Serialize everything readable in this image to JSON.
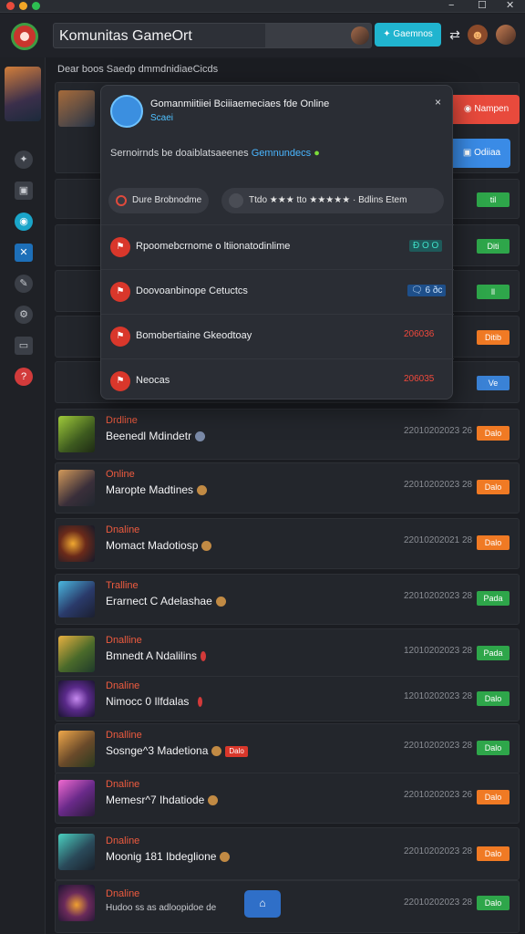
{
  "window": {
    "minimize": "−",
    "maximize": "☐",
    "close": "✕"
  },
  "header": {
    "title": "Komunitas GameOrt",
    "button_label": "Gaemnos",
    "icons": [
      "logo-icon",
      "avatar-icon",
      "swap-icon",
      "game-character-icon",
      "profile-avatar"
    ]
  },
  "main": {
    "title": "Dear boos Saedp dmmdnidiaeCicds"
  },
  "sidebar": {
    "icons": [
      "wrench-icon",
      "chat-icon",
      "globe-icon",
      "close-x-icon",
      "tool-icon",
      "settings-icon",
      "folder-icon",
      "help-icon"
    ]
  },
  "side_actions": [
    {
      "label": "Nampen",
      "color": "#e84a3c"
    },
    {
      "label": "Odiiaa",
      "color": "#3a8be6"
    }
  ],
  "modal": {
    "title": "Gomanmiitiiei Bciiiaemeciaes fde Online",
    "subtitle": "Scaei",
    "close": "×",
    "description": "Sernoirnds be doaiblatsaeenes",
    "description_highlight": "Gemnundecs",
    "chips": [
      {
        "label": "Dure Brobnodme"
      },
      {
        "label": "Ttdo ★★★ tto ★★★★★  · Bdlins Etem"
      }
    ],
    "rows": [
      {
        "label": "Rpoomebcrnome o ltiionatodinlime",
        "value": "Ð O O",
        "value_color": "#35c2b3"
      },
      {
        "label": "Doovoanbinope Cetuctcs",
        "value": "🗨 6 ðc",
        "value_color": "#4aa3ff"
      },
      {
        "label": "Bomobertiaine Gkeodtoay",
        "value": "206036",
        "value_color": "#f0493c"
      },
      {
        "label": "Neocas",
        "value": "206035",
        "value_color": "#f0493c"
      }
    ]
  },
  "peek_pills": [
    {
      "label": "til",
      "color": "#2ea64a"
    },
    {
      "label": "Diti",
      "color": "#2ea64a"
    },
    {
      "label": "ll",
      "color": "#2ea64a"
    },
    {
      "label": "Ditib",
      "color": "#f07a24"
    },
    {
      "label": "Ve",
      "color": "#3a82d6"
    }
  ],
  "rows": [
    {
      "status": "Drdline",
      "name": "Beenedl Mdindetr",
      "date": "22010202023 26",
      "pill": "Dalo",
      "pill_color": "#f07a24"
    },
    {
      "status": "Online",
      "name": "Maropte Madtines",
      "date": "22010202023 28",
      "pill": "Dalo",
      "pill_color": "#f07a24"
    },
    {
      "status": "Dnaline",
      "name": "Momact Madotiosp",
      "date": "22010202021 28",
      "pill": "Dalo",
      "pill_color": "#f07a24"
    },
    {
      "status": "Tralline",
      "name": "Erarnect C Adelashae",
      "date": "22010202023 28",
      "pill": "Pada",
      "pill_color": "#2ea64a"
    },
    {
      "status": "Dnalline",
      "name": "Bmnedt A Ndalilins",
      "date": "12010202023 28",
      "pill": "Pada",
      "pill_color": "#2ea64a"
    },
    {
      "status": "Dnaline",
      "name": "Nimocc 0 Ilfdalas",
      "date": "12010202023 28",
      "pill": "Dalo",
      "pill_color": "#2ea64a"
    },
    {
      "status": "Dnalline",
      "name": "Sosnge^3 Madetiona",
      "date": "22010202023 28",
      "pill": "Dalo",
      "pill_color": "#2ea64a"
    },
    {
      "status": "Dnaline",
      "name": "Memesr^7 Ihdatiode",
      "date": "22010202023 26",
      "pill": "Dalo",
      "pill_color": "#f07a24"
    },
    {
      "status": "Dnaline",
      "name": "Moonig 181 Ibdeglione",
      "date": "22010202023 28",
      "pill": "Dalo",
      "pill_color": "#f07a24"
    },
    {
      "status": "Dnaline",
      "name": "Hudoo ss as adloopidoe de",
      "date": "22010202023 28",
      "pill": "Dalo",
      "pill_color": "#2ea64a"
    }
  ],
  "row_badges": {
    "row3_tag": "Dalo"
  },
  "fab": {
    "icon": "home-icon",
    "label": "⌂"
  }
}
